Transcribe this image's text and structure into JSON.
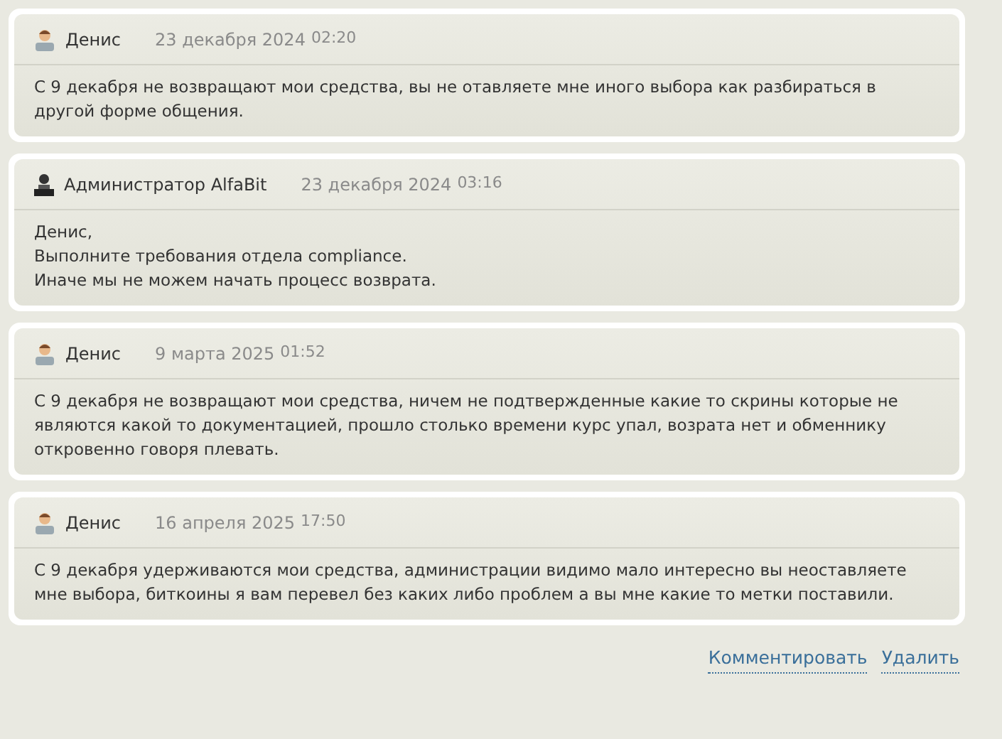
{
  "comments": [
    {
      "author": "Денис",
      "kind": "user",
      "date": "23 декабря 2024",
      "time": "02:20",
      "lines": [
        "С 9 декабря не возвращают мои средства, вы не отавляете мне иного выбора как разбираться в другой форме общения."
      ]
    },
    {
      "author": "Администратор AlfaBit",
      "kind": "admin",
      "date": "23 декабря 2024",
      "time": "03:16",
      "lines": [
        "Денис,",
        "Выполните требования отдела compliance.",
        "Иначе мы не можем начать процесс возврата."
      ]
    },
    {
      "author": "Денис",
      "kind": "user",
      "date": "9 марта 2025",
      "time": "01:52",
      "lines": [
        "С 9 декабря не возвращают мои средства, ничем не подтвержденные какие то скрины которые не являются какой то документацией, прошло столько времени курс упал, возрата нет и обменнику откровенно говоря плевать."
      ]
    },
    {
      "author": "Денис",
      "kind": "user",
      "date": "16 апреля 2025",
      "time": "17:50",
      "lines": [
        "С 9 декабря удерживаются мои средства, администрации видимо мало интересно вы неоставляете мне выбора, биткоины я вам перевел без каких либо проблем а вы мне какие то метки поставили."
      ]
    }
  ],
  "actions": [
    "Комментировать",
    "Удалить"
  ]
}
